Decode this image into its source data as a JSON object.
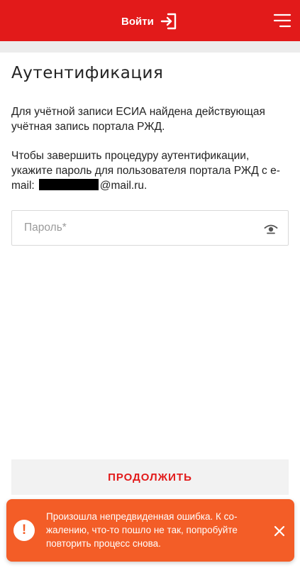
{
  "header": {
    "login_label": "Войти",
    "login_icon": "login-arrow-icon",
    "menu_icon": "hamburger-menu-icon",
    "bg_color": "#e21a1a"
  },
  "main": {
    "title": "Аутентификация",
    "paragraph1": "Для учётной записи ЕСИА найдена действующая учётная запись портала РЖД.",
    "paragraph2": "Чтобы завершить процедуру аутентификации, укажите пароль для пользователя портала РЖД с e-mail:",
    "email_domain": "@mail.ru.",
    "password_field": {
      "placeholder": "Пароль*",
      "value": "",
      "toggle_icon": "eye-icon"
    },
    "continue_label": "ПРОДОЛЖИТЬ"
  },
  "toast": {
    "icon": "exclamation-icon",
    "icon_glyph": "!",
    "message": "Произошла непредвиденная ошибка. К со-жалению, что-то пошло не так, попробуйте повторить процесс снова.",
    "close_icon": "close-icon",
    "bg_color": "#f35d27"
  }
}
